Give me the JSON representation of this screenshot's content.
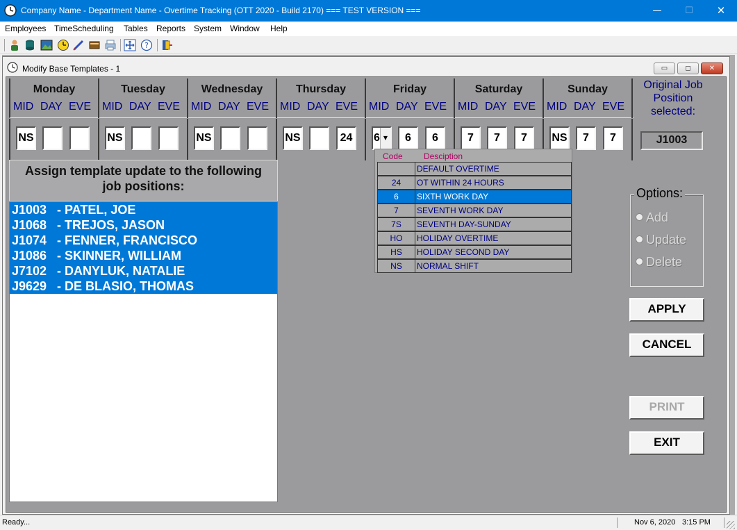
{
  "window": {
    "title": "Company Name - Department Name - Overtime Tracking (OTT 2020 - Build 2170) === TEST VERSION ===",
    "min_glyph": "—",
    "max_glyph": "☐",
    "close_glyph": "✕"
  },
  "menu": [
    "Employees",
    "TimeScheduling",
    "Tables",
    "Reports",
    "System",
    "Window",
    "Help"
  ],
  "toolbar": [
    "employee-icon",
    "database-icon",
    "picture-icon",
    "clock-icon",
    "pen-icon",
    "book-icon",
    "print-icon",
    "navigate-icon",
    "help-icon",
    "exit-door-icon"
  ],
  "child": {
    "title": "Modify Base Templates - 1",
    "min_glyph": "▭",
    "max_glyph": "◻",
    "close_glyph": "✕"
  },
  "days": [
    {
      "name": "Monday",
      "shifts": [
        "MID",
        "DAY",
        "EVE"
      ],
      "values": [
        "NS",
        "",
        ""
      ]
    },
    {
      "name": "Tuesday",
      "shifts": [
        "MID",
        "DAY",
        "EVE"
      ],
      "values": [
        "NS",
        "",
        ""
      ]
    },
    {
      "name": "Wednesday",
      "shifts": [
        "MID",
        "DAY",
        "EVE"
      ],
      "values": [
        "NS",
        "",
        ""
      ]
    },
    {
      "name": "Thursday",
      "shifts": [
        "MID",
        "DAY",
        "EVE"
      ],
      "values": [
        "NS",
        "",
        "24"
      ]
    },
    {
      "name": "Friday",
      "shifts": [
        "MID",
        "DAY",
        "EVE"
      ],
      "values": [
        "6",
        "6",
        "6"
      ]
    },
    {
      "name": "Saturday",
      "shifts": [
        "MID",
        "DAY",
        "EVE"
      ],
      "values": [
        "7",
        "7",
        "7"
      ]
    },
    {
      "name": "Sunday",
      "shifts": [
        "MID",
        "DAY",
        "EVE"
      ],
      "values": [
        "NS",
        "7",
        "7"
      ]
    }
  ],
  "original": {
    "label_lines": [
      "Original Job",
      "Position",
      "selected:"
    ],
    "value": "J1003"
  },
  "assign": {
    "heading_lines": [
      "Assign template update to the following",
      "job positions:"
    ],
    "jobs": [
      {
        "id": "J1003",
        "name": "- PATEL, JOE"
      },
      {
        "id": "J1068",
        "name": "- TREJOS, JASON"
      },
      {
        "id": "J1074",
        "name": "- FENNER, FRANCISCO"
      },
      {
        "id": "J1086",
        "name": "- SKINNER, WILLIAM"
      },
      {
        "id": "J7102",
        "name": "- DANYLUK, NATALIE"
      },
      {
        "id": "J9629",
        "name": "- DE BLASIO, THOMAS"
      }
    ]
  },
  "dropdown": {
    "header_code": "Code",
    "header_desc": "Desciption",
    "selected_index": 2,
    "items": [
      {
        "code": "",
        "desc": "DEFAULT OVERTIME"
      },
      {
        "code": "24",
        "desc": "OT WITHIN 24 HOURS"
      },
      {
        "code": "6",
        "desc": "SIXTH WORK DAY"
      },
      {
        "code": "7",
        "desc": "SEVENTH WORK DAY"
      },
      {
        "code": "7S",
        "desc": "SEVENTH DAY-SUNDAY"
      },
      {
        "code": "HO",
        "desc": "HOLIDAY OVERTIME"
      },
      {
        "code": "HS",
        "desc": "HOLIDAY SECOND DAY"
      },
      {
        "code": "NS",
        "desc": "NORMAL SHIFT"
      }
    ]
  },
  "options": {
    "title": "Options:",
    "items": [
      "Add",
      "Update",
      "Delete"
    ]
  },
  "buttons": {
    "apply": "APPLY",
    "cancel": "CANCEL",
    "print": "PRINT",
    "exit": "EXIT"
  },
  "status": {
    "text": "Ready...",
    "date": "Nov 6, 2020",
    "time": "3:15 PM"
  }
}
